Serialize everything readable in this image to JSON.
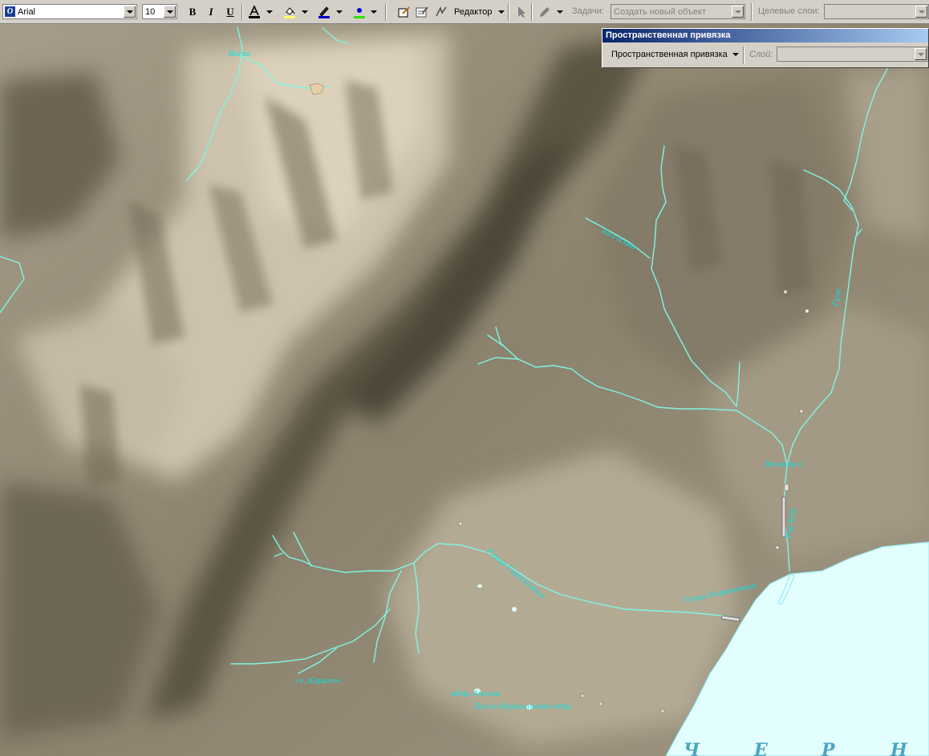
{
  "toolbar": {
    "font_name": "Arial",
    "font_size": "10",
    "bold": "B",
    "italic": "I",
    "underline": "U",
    "editor_label": "Редактор",
    "tasks_label": "Задачи:",
    "tasks_value": "Создать новый объект",
    "target_layer_label": "Целевые слои:",
    "target_layer_value": ""
  },
  "spatial_panel": {
    "title": "Пространственная привязка",
    "menu_label": "Пространственная привязка",
    "layer_label": "Слой:",
    "layer_value": ""
  },
  "map_labels": {
    "top_river": "Васка",
    "bal_alma": "Бал-Алма",
    "right_river": "Гуза",
    "vasilevka": "Ваниграл",
    "river_near_sea": "Узе-Кор",
    "street_upper": "Улица Сарыкамыш",
    "street_lower": "Улица Хырыкамыш",
    "karagach": "гл. Карагач",
    "reservoir": "вдхр. Ачилга",
    "reservoir2": "Бахчи-Муйкальское вдхр.",
    "sea_letters": [
      "Ч",
      "Е",
      "Р",
      "Н"
    ]
  },
  "colors": {
    "river": "#7ff5e4",
    "label": "#00e6e6",
    "sea": "#e2feff",
    "sea_text": "#4aa6c2"
  }
}
